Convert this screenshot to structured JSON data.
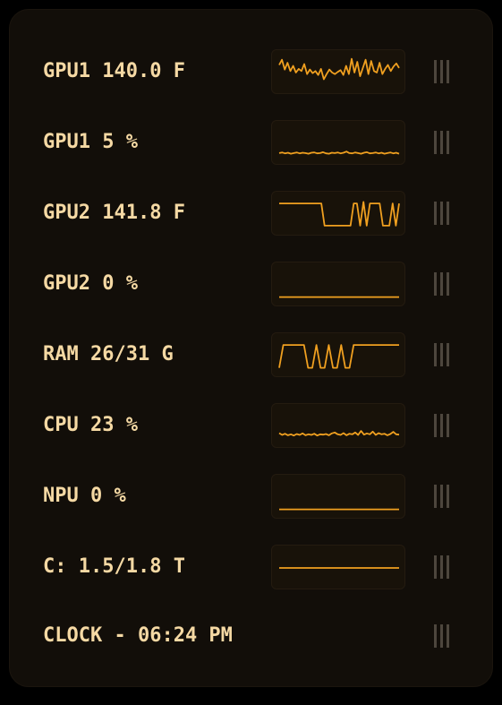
{
  "colors": {
    "background": "#000000",
    "panel": "#120e09",
    "text": "#f5d9a4",
    "graph_line": "#f0a020",
    "handle": "#4d463d"
  },
  "widgets": [
    {
      "label": "GPU1 140.0 F",
      "graph": "gpu1-temperature",
      "values": [
        0.75,
        0.92,
        0.6,
        0.82,
        0.55,
        0.72,
        0.5,
        0.62,
        0.55,
        0.78,
        0.45,
        0.6,
        0.48,
        0.55,
        0.42,
        0.62,
        0.28,
        0.45,
        0.6,
        0.5,
        0.45,
        0.52,
        0.58,
        0.42,
        0.72,
        0.45,
        0.95,
        0.5,
        0.85,
        0.38,
        0.65,
        0.92,
        0.45,
        0.88,
        0.55,
        0.5,
        0.82,
        0.45,
        0.62,
        0.75,
        0.55,
        0.7,
        0.8,
        0.65
      ]
    },
    {
      "label": "GPU1 5 %",
      "graph": "gpu1-usage",
      "values": [
        0.18,
        0.2,
        0.17,
        0.19,
        0.16,
        0.18,
        0.2,
        0.17,
        0.19,
        0.18,
        0.16,
        0.19,
        0.2,
        0.17,
        0.18,
        0.21,
        0.17,
        0.16,
        0.19,
        0.18,
        0.2,
        0.17,
        0.19,
        0.23,
        0.18,
        0.17,
        0.2,
        0.18,
        0.16,
        0.19,
        0.21,
        0.17,
        0.18,
        0.2,
        0.17,
        0.19,
        0.16,
        0.18,
        0.2,
        0.17,
        0.19,
        0.16
      ]
    },
    {
      "label": "GPU2 141.8 F",
      "graph": "gpu2-temperature",
      "values": [
        0.85,
        0.85,
        0.85,
        0.85,
        0.85,
        0.85,
        0.85,
        0.85,
        0.85,
        0.85,
        0.85,
        0.85,
        0.85,
        0.85,
        0.12,
        0.12,
        0.12,
        0.12,
        0.12,
        0.12,
        0.12,
        0.12,
        0.12,
        0.85,
        0.85,
        0.12,
        0.9,
        0.12,
        0.85,
        0.85,
        0.85,
        0.85,
        0.12,
        0.12,
        0.12,
        0.85,
        0.12,
        0.85
      ]
    },
    {
      "label": "GPU2 0 %",
      "graph": "gpu2-usage",
      "values": [
        0.1,
        0.1
      ]
    },
    {
      "label": "RAM 26/31 G",
      "graph": "ram-usage",
      "values": [
        0.1,
        0.85,
        0.85,
        0.85,
        0.85,
        0.85,
        0.85,
        0.1,
        0.1,
        0.85,
        0.1,
        0.1,
        0.85,
        0.1,
        0.1,
        0.85,
        0.1,
        0.1,
        0.85,
        0.85,
        0.85,
        0.85,
        0.85,
        0.85,
        0.85,
        0.85,
        0.85,
        0.85,
        0.85,
        0.85
      ]
    },
    {
      "label": "CPU 23 %",
      "graph": "cpu-usage",
      "values": [
        0.28,
        0.22,
        0.26,
        0.21,
        0.24,
        0.2,
        0.25,
        0.22,
        0.27,
        0.21,
        0.24,
        0.22,
        0.26,
        0.2,
        0.24,
        0.23,
        0.25,
        0.21,
        0.27,
        0.3,
        0.24,
        0.22,
        0.28,
        0.21,
        0.26,
        0.24,
        0.3,
        0.22,
        0.35,
        0.23,
        0.27,
        0.24,
        0.33,
        0.22,
        0.28,
        0.24,
        0.26,
        0.21,
        0.25,
        0.32,
        0.24,
        0.23
      ]
    },
    {
      "label": "NPU 0 %",
      "graph": "npu-usage",
      "values": [
        0.1,
        0.1
      ]
    },
    {
      "label": "C: 1.5/1.8 T",
      "graph": "disk-usage",
      "values": [
        0.5,
        0.5
      ]
    },
    {
      "label": "CLOCK - 06:24 PM",
      "graph": null,
      "values": null
    }
  ]
}
